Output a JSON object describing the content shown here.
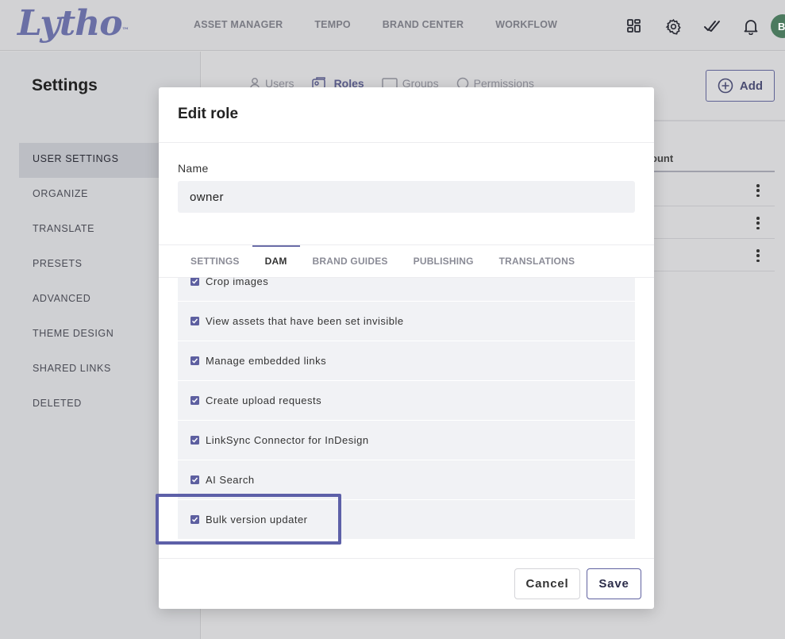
{
  "app": {
    "logo_text": "Lytho",
    "logo_tm": "™",
    "nav": [
      "ASSET MANAGER",
      "TEMPO",
      "BRAND CENTER",
      "WORKFLOW"
    ],
    "avatar_initial": "B",
    "icons": [
      "apps-icon",
      "gear-icon",
      "double-check-icon",
      "bell-icon"
    ]
  },
  "sidebar": {
    "title": "Settings",
    "items": [
      "USER SETTINGS",
      "ORGANIZE",
      "TRANSLATE",
      "PRESETS",
      "ADVANCED",
      "THEME DESIGN",
      "SHARED LINKS",
      "DELETED"
    ],
    "active_index": 0
  },
  "main": {
    "tabs": [
      "Users",
      "Roles",
      "Groups",
      "Permissions"
    ],
    "active_tab": "Roles",
    "add_label": "Add",
    "column_header": "ount"
  },
  "modal": {
    "title": "Edit role",
    "name_label": "Name",
    "name_value": "owner",
    "tabs": [
      "SETTINGS",
      "DAM",
      "BRAND GUIDES",
      "PUBLISHING",
      "TRANSLATIONS"
    ],
    "active_tab": "DAM",
    "permissions": [
      {
        "label": "Crop images",
        "checked": true
      },
      {
        "label": "View assets that have been set invisible",
        "checked": true
      },
      {
        "label": "Manage embedded links",
        "checked": true
      },
      {
        "label": "Create upload requests",
        "checked": true
      },
      {
        "label": "LinkSync Connector for InDesign",
        "checked": true
      },
      {
        "label": "AI Search",
        "checked": true
      },
      {
        "label": "Bulk version updater",
        "checked": true
      }
    ],
    "cancel_label": "Cancel",
    "save_label": "Save"
  },
  "colors": {
    "accent": "#5d5fa0",
    "highlight_border": "#5d60a8"
  }
}
